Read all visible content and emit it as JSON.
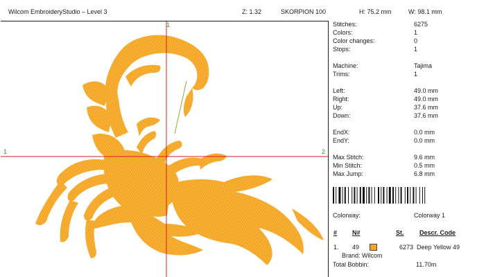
{
  "header": {
    "title": "Wilcom EmbroideryStudio – Level 3",
    "zoom": "Z: 1.32",
    "design_name": "SKORPION 100",
    "height": "H: 75.2 mm",
    "width": "W: 98.1 mm"
  },
  "canvas": {
    "axis_top_label": "1",
    "axis_left_label": "1",
    "axis_right_label": "2",
    "thread_color": "#f5a623",
    "axis_color": "#d02020",
    "guide_color": "#a0a030"
  },
  "stats": [
    {
      "label": "Stitches:",
      "value": "6275"
    },
    {
      "label": "Colors:",
      "value": "1"
    },
    {
      "label": "Color changes:",
      "value": "0"
    },
    {
      "label": "Stops:",
      "value": "1"
    },
    {
      "label": "Machine:",
      "value": "Tajima"
    },
    {
      "label": "Trims:",
      "value": "1"
    },
    {
      "label": "Left:",
      "value": "49.0 mm"
    },
    {
      "label": "Right:",
      "value": "49.0 mm"
    },
    {
      "label": "Up:",
      "value": "37.6 mm"
    },
    {
      "label": "Down:",
      "value": "37.6 mm"
    },
    {
      "label": "EndX:",
      "value": "0.0 mm"
    },
    {
      "label": "EndY:",
      "value": "0.0 mm"
    },
    {
      "label": "Max Stitch:",
      "value": "9.6 mm"
    },
    {
      "label": "Min Stitch:",
      "value": "0.5 mm"
    },
    {
      "label": "Max Jump:",
      "value": "6.8 mm"
    }
  ],
  "colorway": {
    "label": "Colorway:",
    "value": "Colorway 1"
  },
  "table": {
    "headers": {
      "idx": "#",
      "num": "N#",
      "st": "St.",
      "desc": "Descr. Code"
    },
    "rows": [
      {
        "idx": "1.",
        "num": "49",
        "swatch_color": "#f5a623",
        "st": "6273",
        "desc": "Deep Yellow 49"
      }
    ]
  },
  "brand": "Brand: Wilcom",
  "bobbin": {
    "label": "Total Bobbin:",
    "value": "11.70m"
  }
}
